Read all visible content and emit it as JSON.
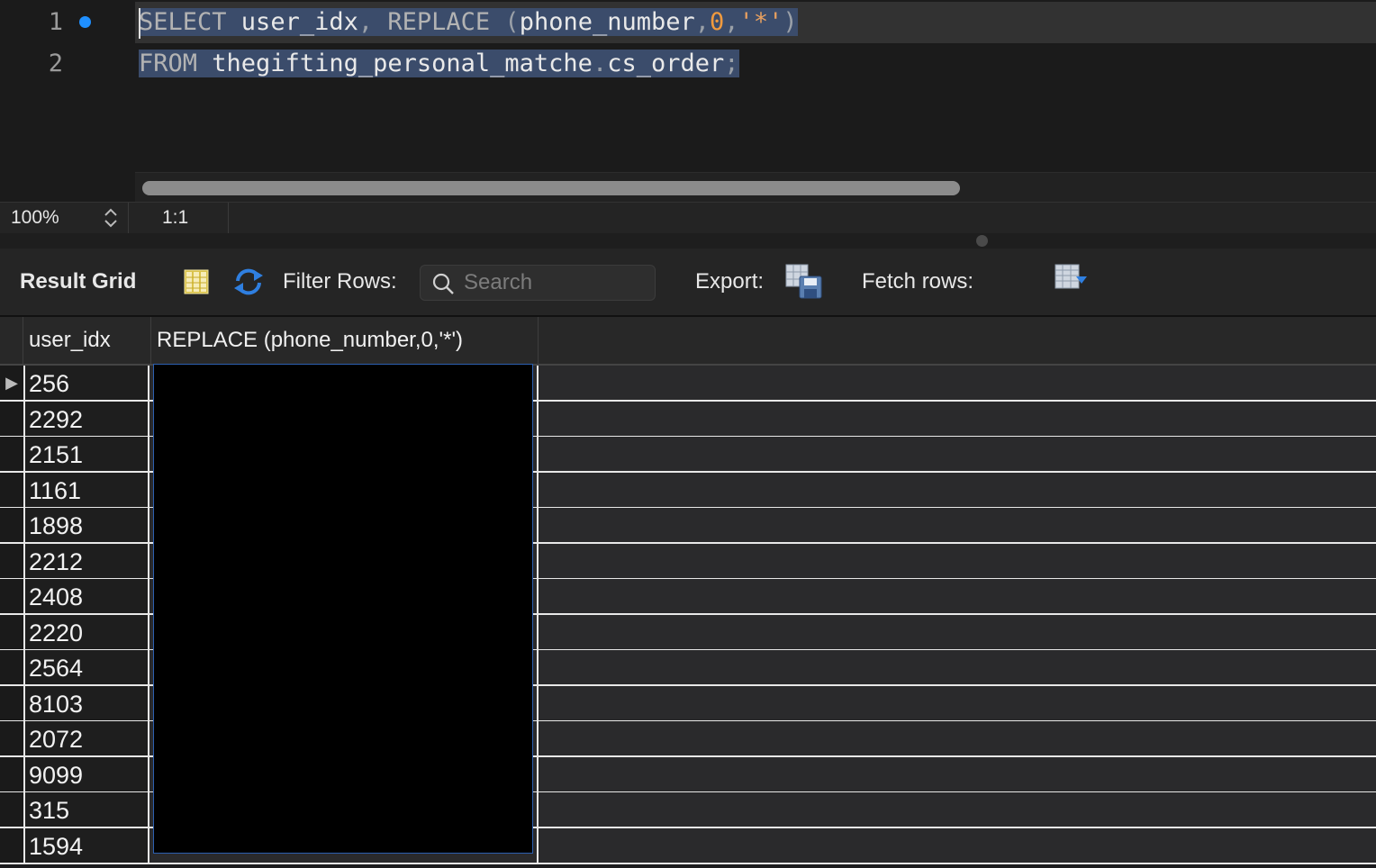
{
  "editor": {
    "lines": [
      {
        "number": "1",
        "tokens": [
          {
            "text": "SELECT",
            "cls": "kw"
          },
          {
            "text": " user_idx",
            "cls": ""
          },
          {
            "text": ",",
            "cls": "punc"
          },
          {
            "text": " REPLACE",
            "cls": "kw"
          },
          {
            "text": " (",
            "cls": "punc"
          },
          {
            "text": "phone_number",
            "cls": ""
          },
          {
            "text": ",",
            "cls": "punc"
          },
          {
            "text": "0",
            "cls": "num"
          },
          {
            "text": ",",
            "cls": "punc"
          },
          {
            "text": "'*'",
            "cls": "str"
          },
          {
            "text": ")",
            "cls": "punc"
          }
        ]
      },
      {
        "number": "2",
        "tokens": [
          {
            "text": "FROM",
            "cls": "kw"
          },
          {
            "text": " thegifting_personal_matche",
            "cls": ""
          },
          {
            "text": ".",
            "cls": "punc"
          },
          {
            "text": "cs_order",
            "cls": ""
          },
          {
            "text": ";",
            "cls": "punc"
          }
        ]
      }
    ]
  },
  "statusbar": {
    "zoom": "100%",
    "position": "1:1"
  },
  "toolbar": {
    "title": "Result Grid",
    "filter_label": "Filter Rows:",
    "search_placeholder": "Search",
    "export_label": "Export:",
    "fetch_label": "Fetch rows:"
  },
  "grid": {
    "columns": [
      "user_idx",
      "REPLACE (phone_number,0,'*')"
    ],
    "rows": [
      "256",
      "2292",
      "2151",
      "1161",
      "1898",
      "2212",
      "2408",
      "2220",
      "2564",
      "8103",
      "2072",
      "9099",
      "315",
      "1594"
    ],
    "current_row_marker": "▶"
  },
  "colors": {
    "selection": "#3b4c6b",
    "number_literal": "#f09a3e",
    "breakpoint_dot": "#1f8fff",
    "refresh_icon": "#2f7fe0"
  }
}
